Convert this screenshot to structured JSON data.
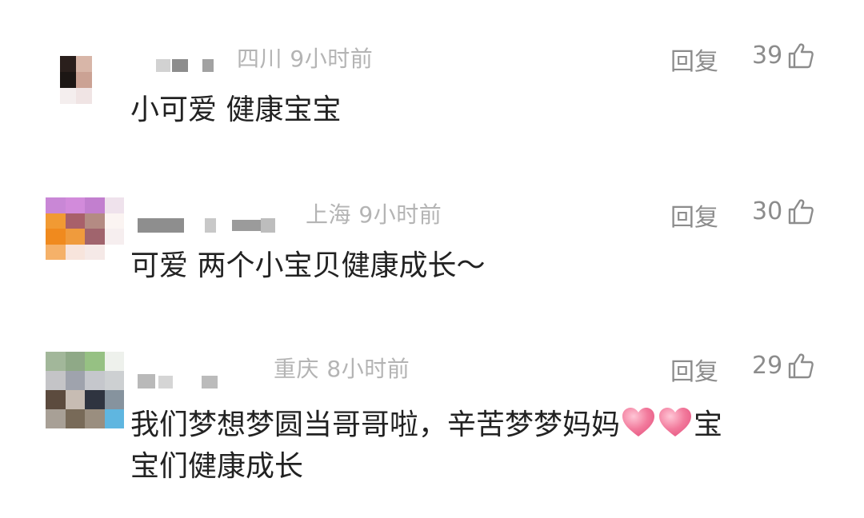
{
  "colors": {
    "meta_text": "#b4b4b4",
    "action_text": "#8c8c8c",
    "content_text": "#222222",
    "heart": "#f27a9c"
  },
  "comments": [
    {
      "location": "四川",
      "time": "9小时前",
      "reply_label": "回复",
      "likes": "39",
      "like_icon": "thumbs-up-icon",
      "content": "小可爱 健康宝宝"
    },
    {
      "location": "上海",
      "time": "9小时前",
      "reply_label": "回复",
      "likes": "30",
      "like_icon": "thumbs-up-icon",
      "content": "可爱 两个小宝贝健康成长～"
    },
    {
      "location": "重庆",
      "time": "8小时前",
      "reply_label": "回复",
      "likes": "29",
      "like_icon": "thumbs-up-icon",
      "content_part1": "我们梦想梦圆当哥哥啦，辛苦梦梦妈妈",
      "content_emoji": "heart-emoji",
      "content_part2": "宝",
      "content_line2": "宝们健康成长"
    }
  ]
}
